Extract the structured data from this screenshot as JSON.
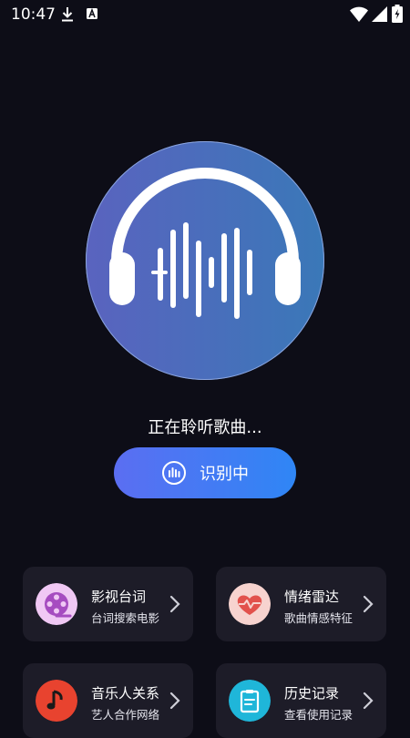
{
  "status_bar": {
    "time": "10:47",
    "icons": [
      "download-icon",
      "a-badge-icon",
      "wifi-icon",
      "signal-icon",
      "battery-icon"
    ]
  },
  "main": {
    "logo_icon": "headphone-waveform-icon",
    "listening_text": "正在聆听歌曲...",
    "identify_button": {
      "label": "识别中",
      "icon": "audio-wave-icon"
    }
  },
  "cards": [
    {
      "title": "影视台词",
      "subtitle": "台词搜索电影",
      "icon": "film-reel-icon",
      "icon_bg": "#f0c8f4",
      "icon_color": "#a64cc0"
    },
    {
      "title": "情绪雷达",
      "subtitle": "歌曲情感特征",
      "icon": "heart-pulse-icon",
      "icon_bg": "#f7d3cf",
      "icon_color": "#e2514c"
    },
    {
      "title": "音乐人关系",
      "subtitle": "艺人合作网络",
      "icon": "music-note-icon",
      "icon_bg": "#e8432f",
      "icon_color": "#1a1a1a"
    },
    {
      "title": "历史记录",
      "subtitle": "查看使用记录",
      "icon": "clipboard-icon",
      "icon_bg": "#1fb6d9",
      "icon_color": "#ffffff"
    }
  ],
  "colors": {
    "background": "#0d0d17",
    "card_background": "#1d1c28",
    "button_gradient_start": "#5b6ef2",
    "button_gradient_end": "#2f86f5"
  }
}
